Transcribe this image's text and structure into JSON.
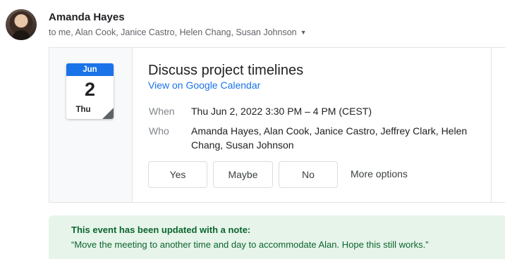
{
  "email": {
    "sender": "Amanda Hayes",
    "recipients": "to me, Alan Cook, Janice Castro, Helen Chang, Susan Johnson",
    "recipients_toggle_icon": "chevron-down-icon"
  },
  "calendar_icon": {
    "month": "Jun",
    "day": "2",
    "weekday": "Thu"
  },
  "event": {
    "title": "Discuss project timelines",
    "view_link": "View on Google Calendar",
    "when_label": "When",
    "when_value": "Thu Jun 2, 2022 3:30 PM – 4 PM (CEST)",
    "who_label": "Who",
    "who_value": "Amanda Hayes, Alan Cook, Janice Castro, Jeffrey Clark, Helen Chang, Susan Johnson"
  },
  "rsvp": {
    "yes": "Yes",
    "maybe": "Maybe",
    "no": "No",
    "more": "More options"
  },
  "note": {
    "title": "This event has been updated with a note:",
    "text": "“Move the meeting to another time and day to accommodate Alan. Hope this still works.”"
  },
  "colors": {
    "accent": "#1a73e8",
    "note_bg": "#e6f4ea",
    "note_text": "#0d652d"
  }
}
